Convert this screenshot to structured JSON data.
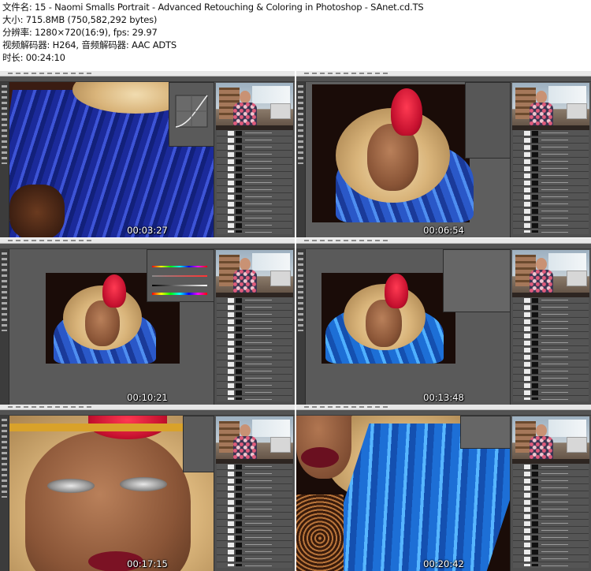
{
  "header": {
    "file_name": "文件名: 15 - Naomi Smalls Portrait - Advanced Retouching & Coloring in Photoshop - SAnet.cd.TS",
    "file_size": "大小: 715.8MB (750,582,292 bytes)",
    "resolution": "分辨率: 1280×720(16:9), fps: 29.97",
    "codecs": "视频解码器: H264, 音频解码器: AAC ADTS",
    "duration": "时长: 00:24:10"
  },
  "thumbnails": [
    {
      "timecode": "00:03:27"
    },
    {
      "timecode": "00:06:54"
    },
    {
      "timecode": "00:10:21"
    },
    {
      "timecode": "00:13:48"
    },
    {
      "timecode": "00:17:15"
    },
    {
      "timecode": "00:20:42"
    }
  ],
  "colors": {
    "photoshop_workspace": "#4a4a4a",
    "feather_blue": "#3d54d6",
    "feather_blue_light": "#4f8ef0",
    "headdress_gold": "#d9b47a",
    "crown_red": "#c4102e"
  },
  "icons": [
    "photoshop-toolbar",
    "webcam-overlay",
    "layers-panel",
    "curves-dialog",
    "hue-saturation-dialog"
  ]
}
